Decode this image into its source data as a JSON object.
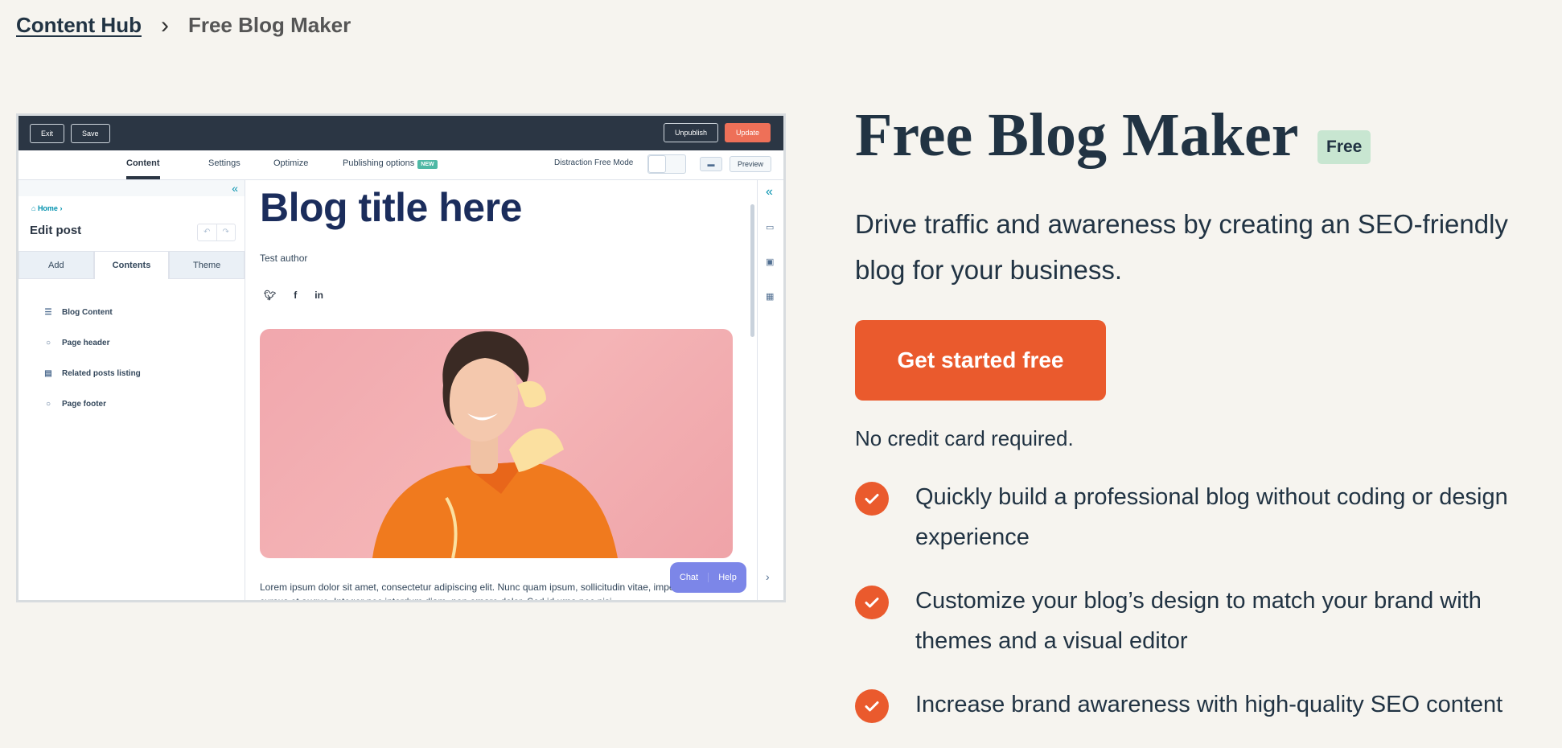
{
  "breadcrumb": {
    "parent": "Content Hub",
    "current": "Free Blog Maker"
  },
  "editor": {
    "topbar": {
      "exit": "Exit",
      "save": "Save",
      "unpublish": "Unpublish",
      "update": "Update"
    },
    "tabs": {
      "content": "Content",
      "settings": "Settings",
      "optimize": "Optimize",
      "publishing": "Publishing options",
      "new_badge": "NEW"
    },
    "distraction_free": "Distraction Free Mode",
    "preview": "Preview",
    "sidebar": {
      "home": "Home",
      "edit_post": "Edit post",
      "tabs": [
        "Add",
        "Contents",
        "Theme"
      ],
      "items": [
        "Blog Content",
        "Page header",
        "Related posts listing",
        "Page footer"
      ]
    },
    "post": {
      "title": "Blog title here",
      "author": "Test author",
      "body": "Lorem ipsum dolor sit amet, consectetur adipiscing elit. Nunc quam ipsum, sollicitudin vitae, imperdiet vitae, cursus et augue. Integer nec interdum diam, non ornare dolor. Sed id urna nec nisi"
    },
    "chat": {
      "chat": "Chat",
      "help": "Help"
    }
  },
  "hero": {
    "title": "Free Blog Maker",
    "badge": "Free",
    "description": "Drive traffic and awareness by creating an SEO-friendly blog for your business.",
    "cta": "Get started free",
    "note": "No credit card required.",
    "features": [
      "Quickly build a professional blog without coding or design experience",
      "Customize your blog’s design to match your brand with themes and a visual editor",
      "Increase brand awareness with high-quality SEO content"
    ]
  },
  "colors": {
    "accent": "#ea5a2d",
    "badge_bg": "#c8e6d1",
    "navy": "#213343"
  }
}
